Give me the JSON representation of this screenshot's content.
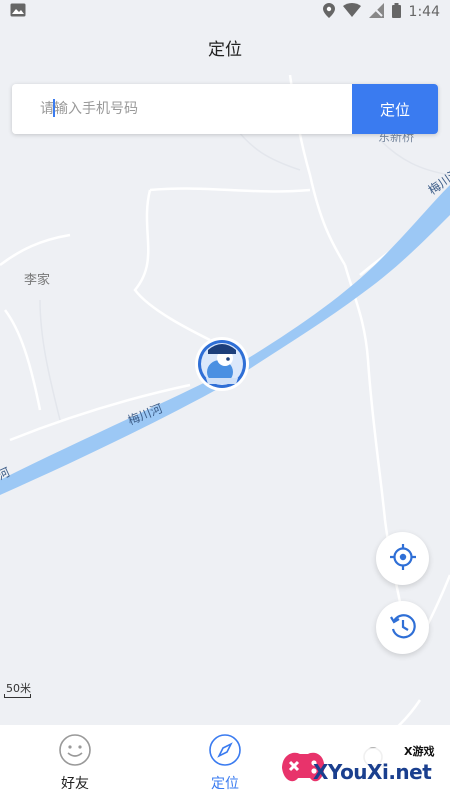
{
  "status_bar": {
    "time": "1:44"
  },
  "header": {
    "title": "定位"
  },
  "search": {
    "placeholder": "请输入手机号码",
    "button_label": "定位"
  },
  "map": {
    "place_labels": {
      "village": "李家",
      "bridge": "东新桥"
    },
    "river_labels": {
      "main": "梅川河",
      "upper": "梅川河",
      "lower": "河"
    },
    "scale_label": "50米"
  },
  "tabs": [
    {
      "label": "好友",
      "active": false,
      "icon": "smile-icon"
    },
    {
      "label": "定位",
      "active": true,
      "icon": "compass-icon"
    },
    {
      "label": "",
      "active": false,
      "icon": "search-icon"
    }
  ],
  "watermark": {
    "brand": "XYouXi.net",
    "tag": "X游戏"
  },
  "colors": {
    "accent": "#3a7bf0",
    "river": "#9cc8f5",
    "map_bg": "#eef0f4"
  }
}
